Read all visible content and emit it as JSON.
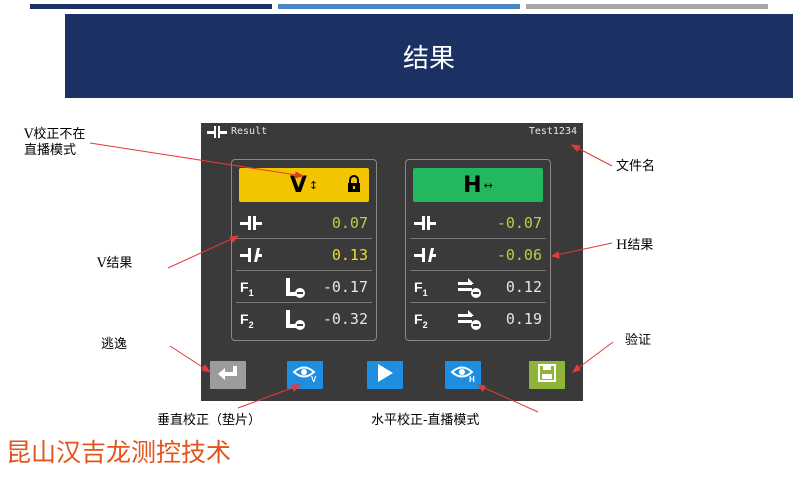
{
  "slide": {
    "title": "结果",
    "top_bar_colors": [
      "#1b3163",
      "#4a86c0",
      "#a7a7a7"
    ],
    "brand": "昆山汉吉龙测控技术"
  },
  "device": {
    "header_icon": "laser-pair-icon",
    "header_title": "Result",
    "file_name": "Test1234",
    "v_panel": {
      "mode_letter": "V",
      "mode_arrow": "↕",
      "mode_color": "#f2c500",
      "lock_icon": "padlock-icon",
      "offset": "0.07",
      "angle": "0.13",
      "f1_value": "-0.17",
      "f2_value": "-0.32",
      "f1_label": "F",
      "f1_sub": "1",
      "f2_label": "F",
      "f2_sub": "2",
      "offset_color": "#b8cf4a",
      "angle_color": "#f2dc28"
    },
    "h_panel": {
      "mode_letter": "H",
      "mode_arrow": "↔",
      "mode_color": "#23b860",
      "offset": "-0.07",
      "angle": "-0.06",
      "f1_value": "0.12",
      "f2_value": "0.19",
      "f1_label": "F",
      "f1_sub": "1",
      "f2_label": "F",
      "f2_sub": "2",
      "offset_color": "#b8cf4a",
      "angle_color": "#b8cf4a"
    },
    "buttons": [
      {
        "name": "escape",
        "icon": "return-arrow-icon",
        "color": "#9c9c9c"
      },
      {
        "name": "vertical-shim",
        "icon": "eye-v-icon",
        "color": "#1e8fe0"
      },
      {
        "name": "play",
        "icon": "play-icon",
        "color": "#1e8fe0"
      },
      {
        "name": "horizontal-live",
        "icon": "eye-h-icon",
        "color": "#1e8fe0"
      },
      {
        "name": "verify",
        "icon": "save-check-icon",
        "color": "#8fb43a"
      }
    ]
  },
  "annotations": {
    "v_not_live_l1": "V校正不在",
    "v_not_live_l2": "直播模式",
    "file_name": "文件名",
    "v_result": "V结果",
    "h_result": "H结果",
    "escape": "逃逸",
    "verify": "验证",
    "vertical_shim": "垂直校正（垫片）",
    "horizontal_live": "水平校正-直播模式"
  }
}
